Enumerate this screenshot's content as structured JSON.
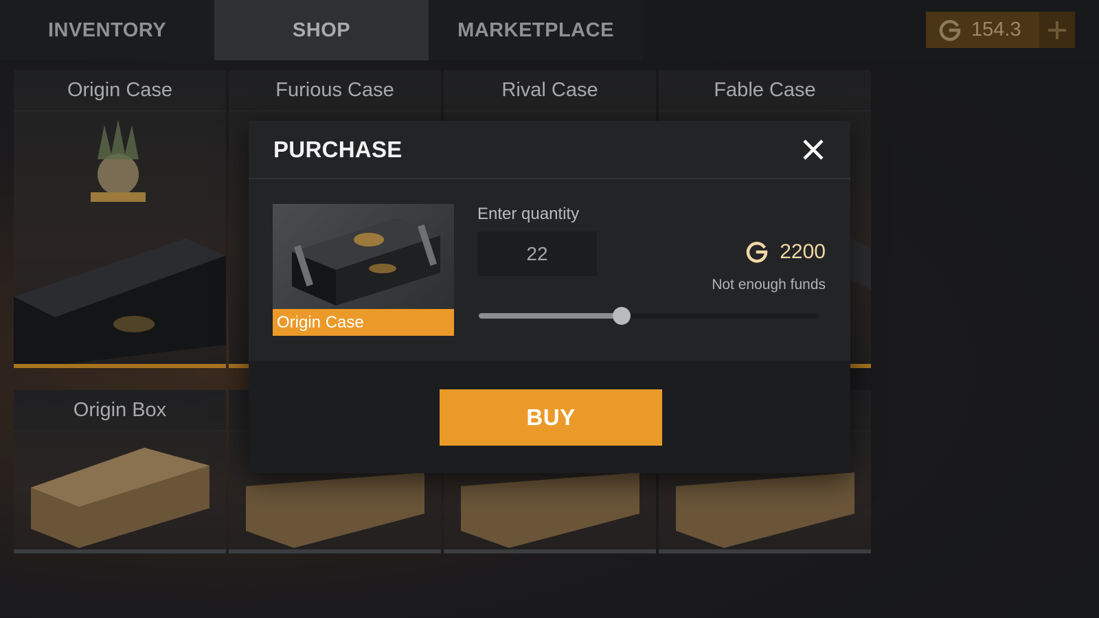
{
  "nav": {
    "tabs": [
      {
        "label": "INVENTORY",
        "active": false
      },
      {
        "label": "SHOP",
        "active": true
      },
      {
        "label": "MARKETPLACE",
        "active": false
      }
    ],
    "balance": {
      "icon": "g-coin-icon",
      "amount": "154.3",
      "add_icon": "plus-icon"
    }
  },
  "shop": {
    "row1": [
      {
        "title": "Origin Case"
      },
      {
        "title": "Furious Case"
      },
      {
        "title": "Rival Case"
      },
      {
        "title": "Fable Case"
      }
    ],
    "row2": [
      {
        "title": "Origin Box"
      },
      {
        "title": ""
      },
      {
        "title": ""
      },
      {
        "title": ""
      }
    ]
  },
  "modal": {
    "title": "PURCHASE",
    "close_icon": "close-icon",
    "item_name": "Origin Case",
    "quantity_label": "Enter quantity",
    "quantity_value": "22",
    "price": "2200",
    "price_icon": "g-coin-icon",
    "funds_message": "Not enough funds",
    "slider_fraction": 0.42,
    "buy_label": "BUY"
  },
  "colors": {
    "accent": "#eb9a2a",
    "price_text": "#f1d8a6",
    "currency_bg": "#4a3615"
  }
}
